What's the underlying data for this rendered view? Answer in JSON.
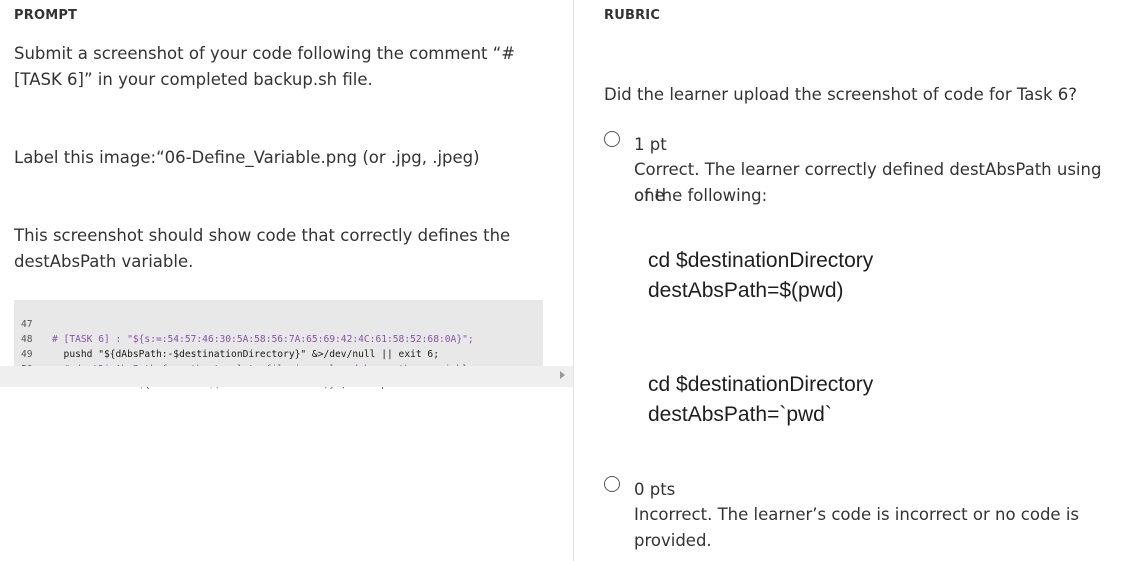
{
  "prompt": {
    "header": "PROMPT",
    "para1_line1": "Submit a screenshot of your code following the comment “#",
    "para1_line2": "[TASK 6]” in your completed backup.sh file.",
    "para2": "Label this image:“06-Define_Variable.png (or .jpg, .jpeg)",
    "para3_line1": "This screenshot should show code that correctly defines the",
    "para3_line2": "destAbsPath variable.",
    "code_lines": [
      {
        "num": "47",
        "text": "# [TASK 6] : \"${s:=:54:57:46:30:5A:58:56:7A:65:69:42:4C:61:58:52:68:0A}\";"
      },
      {
        "num": "48",
        "text": "  pushd \"${dAbsPath:-$destinationDirectory}\" &>/dev/null || exit 6;"
      },
      {
        "num": "49",
        "text": "  # destDirAbsPath from the template file is replaced by another variable name"
      },
      {
        "num": "50",
        "text": "  destAbsPath=\"${dAbsPath:-$(dirs -c && dirs -l)}\"; # as per lab instructions"
      }
    ]
  },
  "rubric": {
    "header": "RUBRIC",
    "question": "Did the learner upload the screenshot of code for Task 6?",
    "option1": {
      "points": "1 pt",
      "desc_line1": "Correct. The learner correctly defined destAbsPath using one",
      "desc_line2": "of the following:",
      "snippet1_line1": "cd $destinationDirectory",
      "snippet1_line2": "destAbsPath=$(pwd)",
      "snippet2_line1": "cd $destinationDirectory",
      "snippet2_line2": "destAbsPath=`pwd`"
    },
    "option2": {
      "points": "0 pts",
      "desc_line1": "Incorrect. The learner’s code is incorrect or no code is",
      "desc_line2": "provided."
    }
  }
}
